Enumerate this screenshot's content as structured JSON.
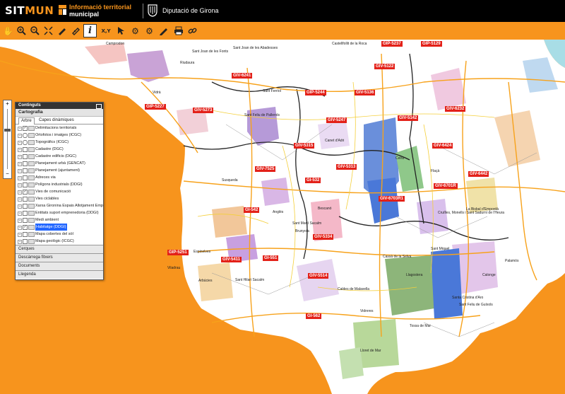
{
  "header": {
    "logo_sit": "SIT",
    "logo_mun": "MUN",
    "tagline_1": "Informació territorial",
    "tagline_2": "municipal",
    "org_name": "Diputació de Girona",
    "bg_color": "#000000",
    "accent_color": "#f7941d"
  },
  "toolbar": {
    "tools": [
      {
        "icon": "pan-hand-icon"
      },
      {
        "icon": "zoom-in-icon"
      },
      {
        "icon": "zoom-out-icon"
      },
      {
        "icon": "full-extent-icon"
      },
      {
        "icon": "measure-length-icon"
      },
      {
        "icon": "measure-area-icon"
      },
      {
        "icon": "info-icon"
      },
      {
        "icon": "coordinates-icon",
        "label": "X,Y"
      },
      {
        "icon": "select-icon"
      },
      {
        "icon": "gear-icon"
      },
      {
        "icon": "gear-settings-icon"
      },
      {
        "icon": "edit-pencil-icon"
      },
      {
        "icon": "print-icon"
      },
      {
        "icon": "link-icon"
      }
    ]
  },
  "panel": {
    "title": "Continguts",
    "section": "Cartografia",
    "tabs": [
      "Arbre",
      "Capes dinàmiques"
    ],
    "layers": [
      {
        "label": "Delimitacions territorials",
        "checked": true
      },
      {
        "label": "Ortofotos i imatges (ICGC)",
        "checked": false
      },
      {
        "label": "Topogràfics (ICGC)",
        "checked": false
      },
      {
        "label": "Cadastre (DGC)",
        "checked": false
      },
      {
        "label": "Cadastre edificis (DGC)",
        "checked": false
      },
      {
        "label": "Planejament urbà (GENCAT)",
        "checked": false
      },
      {
        "label": "Planejament (ajuntament)",
        "checked": false
      },
      {
        "label": "Adreces via",
        "checked": false
      },
      {
        "label": "Polígons industrials (DDGI)",
        "checked": false
      },
      {
        "label": "Vies de comunicació",
        "checked": true
      },
      {
        "label": "Vies ciclables",
        "checked": false
      },
      {
        "label": "Xarxa Gironina Espais Allotjament Emp",
        "checked": false
      },
      {
        "label": "Entitats suport emprenedoria (DDGI)",
        "checked": false
      },
      {
        "label": "Medi ambient",
        "checked": false
      },
      {
        "label": "Habitatge (DDGI)",
        "checked": true,
        "highlight": true
      },
      {
        "label": "Mapa cobertes del sòl",
        "checked": false
      },
      {
        "label": "Mapa geològic (ICGC)",
        "checked": false
      }
    ],
    "sections": [
      "Cerques",
      "Descàrrega fitxers",
      "Documents",
      "Llegenda"
    ]
  },
  "map": {
    "road_labels": [
      {
        "text": "GIP-5237"
      },
      {
        "text": "GIP-5129"
      },
      {
        "text": "GIV-6241"
      },
      {
        "text": "GIP-5244"
      },
      {
        "text": "GIV-5136"
      },
      {
        "text": "GIV-5122"
      },
      {
        "text": "GIP-5227"
      },
      {
        "text": "GIV-5273"
      },
      {
        "text": "GIV-5247"
      },
      {
        "text": "GIV-5142"
      },
      {
        "text": "GIV-6232"
      },
      {
        "text": "GIV-5315"
      },
      {
        "text": "GIV-5313"
      },
      {
        "text": "GIV-6424"
      },
      {
        "text": "GIV-6442"
      },
      {
        "text": "GIV-7525"
      },
      {
        "text": "GI-532"
      },
      {
        "text": "GIV-6703R1"
      },
      {
        "text": "GI-542"
      },
      {
        "text": "GIV-5334"
      },
      {
        "text": "GIP-5251"
      },
      {
        "text": "GIV-5411"
      },
      {
        "text": "GI-551"
      },
      {
        "text": "GIV-5514"
      },
      {
        "text": "GI-562"
      },
      {
        "text": "GIV-6701R"
      }
    ],
    "towns": [
      {
        "name": "Sant Joan de les Abadesses"
      },
      {
        "name": "Vidrà"
      },
      {
        "name": "Sant Feliu de Pallerols"
      },
      {
        "name": "Canet d'Adri"
      },
      {
        "name": "Bescanó"
      },
      {
        "name": "Susqueda"
      },
      {
        "name": "Anglès"
      },
      {
        "name": "Sant Martí Sacalm"
      },
      {
        "name": "Brunyola"
      },
      {
        "name": "Sant Hilari Sacalm"
      },
      {
        "name": "Espinelves"
      },
      {
        "name": "Viladrau"
      },
      {
        "name": "Arbúcies"
      },
      {
        "name": "Cassà de la Selva"
      },
      {
        "name": "Caldes de Malavella"
      },
      {
        "name": "Vidreres"
      },
      {
        "name": "Lloret de Mar"
      },
      {
        "name": "Tossa de Mar"
      },
      {
        "name": "Llagostera"
      },
      {
        "name": "Santa Cristina d'Aro"
      },
      {
        "name": "Palamós"
      },
      {
        "name": "Calonge"
      },
      {
        "name": "Sant Feliu de Guíxols"
      },
      {
        "name": "Cruïlles, Monells i Sant Sadurní de l'Heura"
      },
      {
        "name": "La Bisbal d'Empordà"
      },
      {
        "name": "Sant Miquel"
      },
      {
        "name": "Celrà"
      },
      {
        "name": "Flaçà"
      },
      {
        "name": "Camprodon"
      },
      {
        "name": "Sant Joan de les Fonts"
      },
      {
        "name": "Sant Ferriol"
      },
      {
        "name": "Riudaura"
      },
      {
        "name": "Castellfollit de la Roca"
      }
    ],
    "land_color": "#ffffff",
    "sea_color": "#f7941d",
    "water_color": "#a8dde6"
  }
}
